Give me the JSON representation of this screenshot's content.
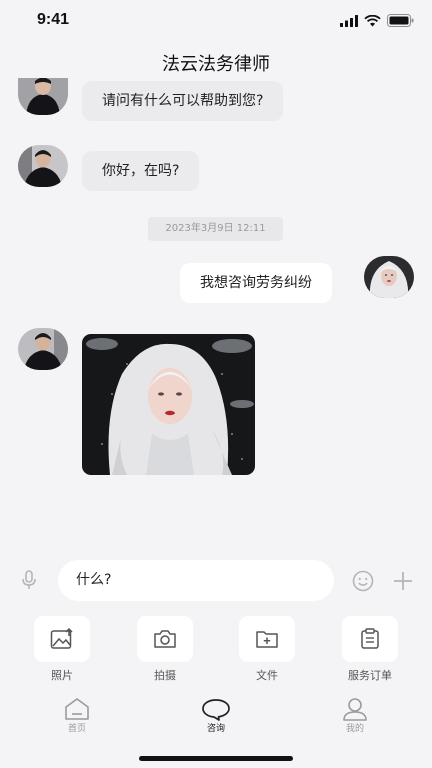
{
  "status_bar": {
    "time": "9:41"
  },
  "header": {
    "title": "法云法务律师"
  },
  "messages": [
    {
      "side": "left",
      "text": "请问有什么可以帮助到您?"
    },
    {
      "side": "left",
      "text": "你好，在吗?"
    },
    {
      "type": "timestamp",
      "text": "2023年3月9日 12:11"
    },
    {
      "side": "right",
      "text": "我想咨询劳务纠纷"
    },
    {
      "side": "left",
      "type": "image"
    }
  ],
  "composer": {
    "value": "什么?"
  },
  "tools": [
    {
      "label": "照片",
      "icon": "image-icon"
    },
    {
      "label": "拍摄",
      "icon": "camera-icon"
    },
    {
      "label": "文件",
      "icon": "folder-icon"
    },
    {
      "label": "服务订单",
      "icon": "order-icon"
    }
  ],
  "tabbar": [
    {
      "label": "首页",
      "icon": "home-icon",
      "active": false
    },
    {
      "label": "咨询",
      "icon": "chat-icon",
      "active": true
    },
    {
      "label": "我的",
      "icon": "profile-icon",
      "active": false
    }
  ],
  "colors": {
    "background": "#f4f4f6",
    "bubble_left": "#ebebed",
    "bubble_right": "#ffffff",
    "active_tab": "#222222",
    "inactive_tab": "#9a9a9a"
  }
}
